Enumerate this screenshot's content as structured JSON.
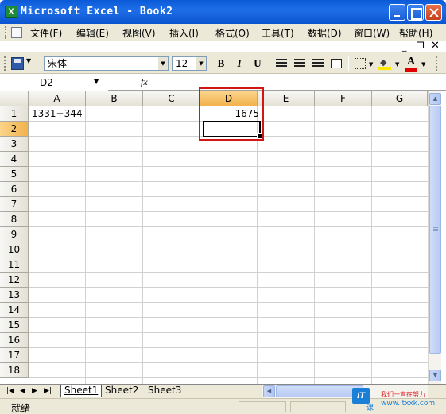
{
  "window": {
    "app_icon": "excel-icon",
    "title": "Microsoft Excel - Book2"
  },
  "menu": {
    "items": [
      "文件(F)",
      "编辑(E)",
      "视图(V)",
      "插入(I)",
      "格式(O)",
      "工具(T)",
      "数据(D)",
      "窗口(W)",
      "帮助(H)"
    ]
  },
  "toolbar": {
    "font_name": "宋体",
    "font_size": "12",
    "bold": "B",
    "italic": "I",
    "underline": "U",
    "font_color_letter": "A",
    "fill_color": "#ffea00",
    "font_color": "#e00000"
  },
  "formula_bar": {
    "name_box": "D2",
    "fx_label": "fx",
    "formula": ""
  },
  "sheet": {
    "columns": [
      "A",
      "B",
      "C",
      "D",
      "E",
      "F",
      "G"
    ],
    "rows": [
      "1",
      "2",
      "3",
      "4",
      "5",
      "6",
      "7",
      "8",
      "9",
      "10",
      "11",
      "12",
      "13",
      "14",
      "15",
      "16",
      "17",
      "18"
    ],
    "active_column": "D",
    "active_row": "2",
    "cells": {
      "A1": "1331+344",
      "D1": "1675",
      "D2": ""
    },
    "highlight_color": "#d11616",
    "header_active_color": "#f2b24c"
  },
  "tabs": {
    "sheets": [
      "Sheet1",
      "Sheet2",
      "Sheet3"
    ],
    "active": "Sheet1"
  },
  "status": {
    "text": "就绪"
  },
  "watermark": {
    "logo_text": "IT",
    "course_text": "课",
    "slogan": "我们一直在努力",
    "url": "www.itxxk.com"
  }
}
